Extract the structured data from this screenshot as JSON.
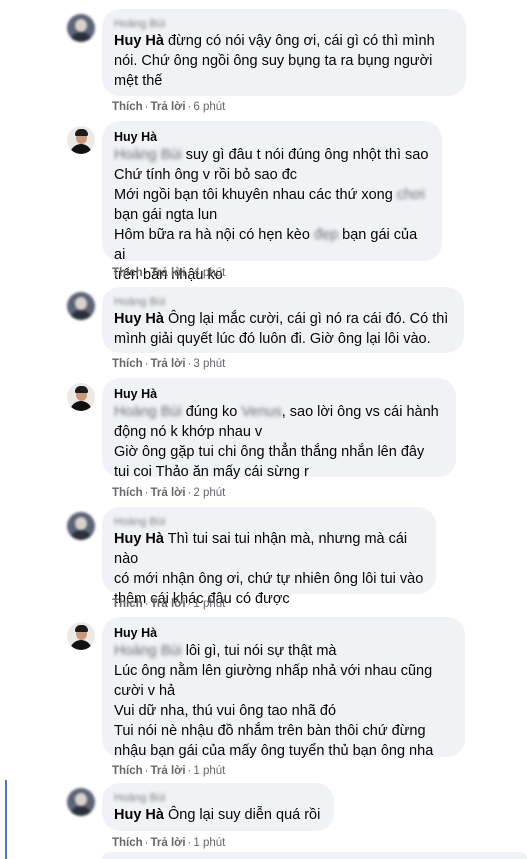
{
  "comments": [
    {
      "author": "Hoàng Bùi",
      "lines": [
        {
          "mention": "Huy Hà",
          "text": " đừng có nói vậy ông ơi, cái gì có thì mình"
        },
        {
          "text": "nói. Chứ ông ngồi ông suy bụng ta ra bụng người"
        },
        {
          "text": "mệt thế"
        }
      ],
      "like": "Thích",
      "reply": "Trả lời",
      "time": "6 phút"
    },
    {
      "author": "Huy Hà",
      "lines": [
        {
          "mention": "Hoàng Bùi",
          "text": " suy gì đâu t nói đúng ông nhột thì sao"
        },
        {
          "text": "Chứ tính ông v rồi bỏ sao đc"
        },
        {
          "text": "Mới ngồi bạn tôi khuyên nhau các thứ xong ",
          "blur": "chơi"
        },
        {
          "text": "bạn gái ngta lun"
        },
        {
          "text": "Hôm bữa ra hà nội có hẹn kèo ",
          "blur": "đẹp",
          "text2": " bạn gái của ai"
        },
        {
          "text": "trên bàn nhậu ko"
        }
      ],
      "like": "Thích",
      "reply": "Trả lời",
      "time": "4 phút"
    },
    {
      "author": "Hoàng Bùi",
      "lines": [
        {
          "mention": "Huy Hà",
          "text": " Ông lại mắc cười, cái gì nó ra cái đó. Có thì"
        },
        {
          "text": "mình giải quyết lúc đó luôn đi. Giờ ông lại lôi vào."
        }
      ],
      "like": "Thích",
      "reply": "Trả lời",
      "time": "3 phút"
    },
    {
      "author": "Huy Hà",
      "lines": [
        {
          "mention": "Hoàng Bùi",
          "text": " đúng ko ",
          "blur": "Venus",
          "text2": ", sao lời ông vs cái hành"
        },
        {
          "text": "động nó k khớp nhau v"
        },
        {
          "text": "Giờ ông gặp tui chi ông thẳn thắng nhắn lên đây"
        },
        {
          "text": "tui coi Thảo ăn mấy cái sừng r"
        }
      ],
      "like": "Thích",
      "reply": "Trả lời",
      "time": "2 phút"
    },
    {
      "author": "Hoàng Bùi",
      "lines": [
        {
          "mention": "Huy Hà",
          "text": " Thì tui sai tui nhận mà, nhưng mà cái nào"
        },
        {
          "text": "có mới nhận ông ơi, chứ tự nhiên ông lôi tui vào"
        },
        {
          "text": "thêm cái khác đâu có được"
        }
      ],
      "like": "Thích",
      "reply": "Trả lời",
      "time": "1 phút"
    },
    {
      "author": "Huy Hà",
      "lines": [
        {
          "mention": "Hoàng Bùi",
          "text": " lôi gì, tui nói sự thật mà"
        },
        {
          "text": "Lúc ông nằm lên giường nhấp nhả với nhau cũng"
        },
        {
          "text": "cười v hả"
        },
        {
          "text": "Vui dữ nha, thú vui ông tao nhã đó"
        },
        {
          "text": "Tui nói nè nhậu đồ nhắm trên bàn thôi chứ đừng"
        },
        {
          "text": "nhậu bạn gái của mấy ông tuyển thủ bạn ông nha"
        }
      ],
      "like": "Thích",
      "reply": "Trả lời",
      "time": "1 phút"
    },
    {
      "author": "Hoàng Bùi",
      "lines": [
        {
          "mention": "Huy Hà",
          "text": " Ông lại suy diễn quá rồi"
        }
      ],
      "like": "Thích",
      "reply": "Trả lời",
      "time": "1 phút"
    }
  ]
}
